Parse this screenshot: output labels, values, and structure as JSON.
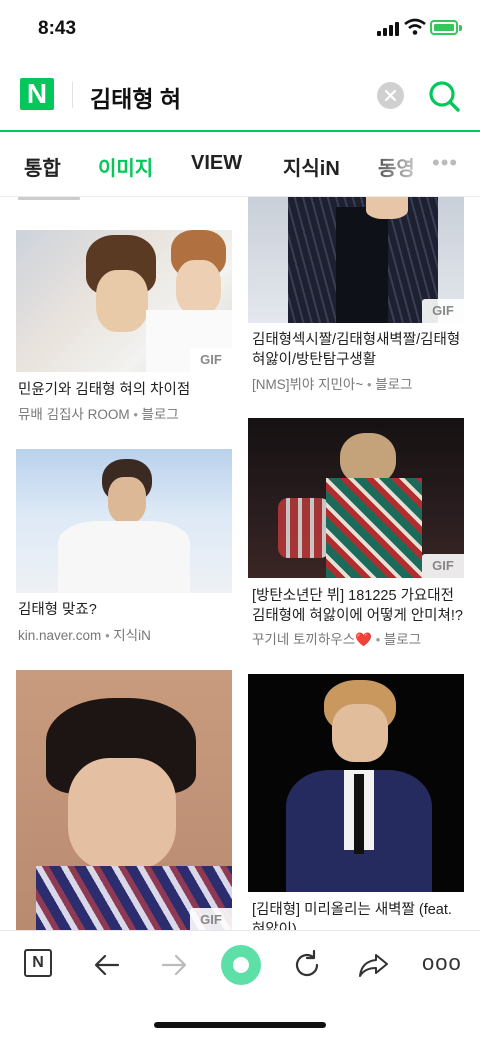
{
  "status_bar": {
    "time": "8:43"
  },
  "search": {
    "logo": "N",
    "query": "김태형 혀"
  },
  "tabs": [
    "통합",
    "이미지",
    "VIEW",
    "지식iN",
    "동영"
  ],
  "active_tab": "이미지",
  "results": [
    {
      "caption": "민윤기와 김태형 혀의 차이점",
      "source": "뮤배 김집사 ROOM",
      "type": "블로그",
      "gif": "GIF"
    },
    {
      "caption": "김태형섹시짤/김태형새벽짤/김태형 혀앓이/방탄탐구생활",
      "source": "[NMS]뷔야 지민아~",
      "type": "블로그",
      "gif": "GIF"
    },
    {
      "caption": "김태형 맞죠?",
      "source": "kin.naver.com",
      "type": "지식iN"
    },
    {
      "caption": "[방탄소년단 뷔] 181225 가요대전 김태형에 혀앓이에 어떻게 안미쳐!?",
      "source": "꾸기네 토끼하우스❤️",
      "type": "블로그",
      "gif": "GIF"
    },
    {
      "caption": "",
      "source": "",
      "type": "",
      "gif": "GIF"
    },
    {
      "caption": "[김태형] 미리올리는 새벽짤 (feat. 혀앓이)",
      "source": "",
      "type": ""
    }
  ],
  "bottom_bar": {
    "home_label": "N"
  },
  "colors": {
    "accent": "#03c75a",
    "float_button": "#5ce0a8"
  }
}
